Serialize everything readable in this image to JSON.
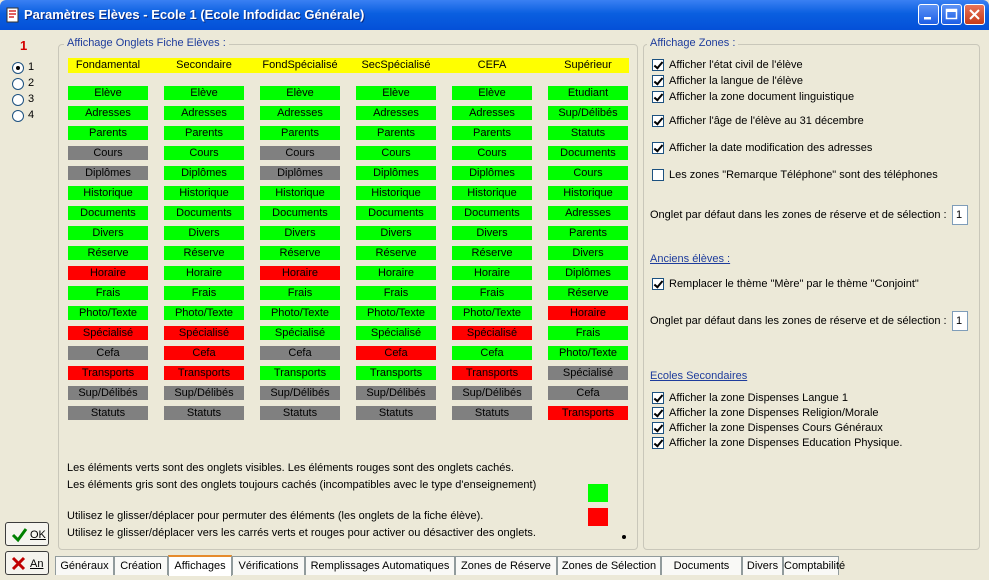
{
  "window": {
    "title": "Paramètres Elèves - Ecole 1 (Ecole Infodidac Générale)"
  },
  "left": {
    "page_number": "1",
    "radios": [
      {
        "label": "1",
        "checked": true
      },
      {
        "label": "2",
        "checked": false
      },
      {
        "label": "3",
        "checked": false
      },
      {
        "label": "4",
        "checked": false
      }
    ],
    "ok_label": "OK",
    "cancel_label": "An"
  },
  "onglets": {
    "title": "Affichage Onglets Fiche Elèves :",
    "columns": [
      {
        "name": "Fondamental",
        "items": [
          [
            "Elève",
            "green"
          ],
          [
            "Adresses",
            "green"
          ],
          [
            "Parents",
            "green"
          ],
          [
            "Cours",
            "gray"
          ],
          [
            "Diplômes",
            "gray"
          ],
          [
            "Historique",
            "green"
          ],
          [
            "Documents",
            "green"
          ],
          [
            "Divers",
            "green"
          ],
          [
            "Réserve",
            "green"
          ],
          [
            "Horaire",
            "red"
          ],
          [
            "Frais",
            "green"
          ],
          [
            "Photo/Texte",
            "green"
          ],
          [
            "Spécialisé",
            "red"
          ],
          [
            "Cefa",
            "gray"
          ],
          [
            "Transports",
            "red"
          ],
          [
            "Sup/Délibés",
            "gray"
          ],
          [
            "Statuts",
            "gray"
          ]
        ]
      },
      {
        "name": "Secondaire",
        "items": [
          [
            "Elève",
            "green"
          ],
          [
            "Adresses",
            "green"
          ],
          [
            "Parents",
            "green"
          ],
          [
            "Cours",
            "green"
          ],
          [
            "Diplômes",
            "green"
          ],
          [
            "Historique",
            "green"
          ],
          [
            "Documents",
            "green"
          ],
          [
            "Divers",
            "green"
          ],
          [
            "Réserve",
            "green"
          ],
          [
            "Horaire",
            "green"
          ],
          [
            "Frais",
            "green"
          ],
          [
            "Photo/Texte",
            "green"
          ],
          [
            "Spécialisé",
            "red"
          ],
          [
            "Cefa",
            "red"
          ],
          [
            "Transports",
            "red"
          ],
          [
            "Sup/Délibés",
            "gray"
          ],
          [
            "Statuts",
            "gray"
          ]
        ]
      },
      {
        "name": "FondSpécialisé",
        "items": [
          [
            "Elève",
            "green"
          ],
          [
            "Adresses",
            "green"
          ],
          [
            "Parents",
            "green"
          ],
          [
            "Cours",
            "gray"
          ],
          [
            "Diplômes",
            "gray"
          ],
          [
            "Historique",
            "green"
          ],
          [
            "Documents",
            "green"
          ],
          [
            "Divers",
            "green"
          ],
          [
            "Réserve",
            "green"
          ],
          [
            "Horaire",
            "red"
          ],
          [
            "Frais",
            "green"
          ],
          [
            "Photo/Texte",
            "green"
          ],
          [
            "Spécialisé",
            "green"
          ],
          [
            "Cefa",
            "gray"
          ],
          [
            "Transports",
            "green"
          ],
          [
            "Sup/Délibés",
            "gray"
          ],
          [
            "Statuts",
            "gray"
          ]
        ]
      },
      {
        "name": "SecSpécialisé",
        "items": [
          [
            "Elève",
            "green"
          ],
          [
            "Adresses",
            "green"
          ],
          [
            "Parents",
            "green"
          ],
          [
            "Cours",
            "green"
          ],
          [
            "Diplômes",
            "green"
          ],
          [
            "Historique",
            "green"
          ],
          [
            "Documents",
            "green"
          ],
          [
            "Divers",
            "green"
          ],
          [
            "Réserve",
            "green"
          ],
          [
            "Horaire",
            "green"
          ],
          [
            "Frais",
            "green"
          ],
          [
            "Photo/Texte",
            "green"
          ],
          [
            "Spécialisé",
            "green"
          ],
          [
            "Cefa",
            "red"
          ],
          [
            "Transports",
            "green"
          ],
          [
            "Sup/Délibés",
            "gray"
          ],
          [
            "Statuts",
            "gray"
          ]
        ]
      },
      {
        "name": "CEFA",
        "items": [
          [
            "Elève",
            "green"
          ],
          [
            "Adresses",
            "green"
          ],
          [
            "Parents",
            "green"
          ],
          [
            "Cours",
            "green"
          ],
          [
            "Diplômes",
            "green"
          ],
          [
            "Historique",
            "green"
          ],
          [
            "Documents",
            "green"
          ],
          [
            "Divers",
            "green"
          ],
          [
            "Réserve",
            "green"
          ],
          [
            "Horaire",
            "green"
          ],
          [
            "Frais",
            "green"
          ],
          [
            "Photo/Texte",
            "green"
          ],
          [
            "Spécialisé",
            "red"
          ],
          [
            "Cefa",
            "green"
          ],
          [
            "Transports",
            "red"
          ],
          [
            "Sup/Délibés",
            "gray"
          ],
          [
            "Statuts",
            "gray"
          ]
        ]
      },
      {
        "name": "Supérieur",
        "items": [
          [
            "Etudiant",
            "green"
          ],
          [
            "Sup/Délibés",
            "green"
          ],
          [
            "Statuts",
            "green"
          ],
          [
            "Documents",
            "green"
          ],
          [
            "Cours",
            "green"
          ],
          [
            "Historique",
            "green"
          ],
          [
            "Adresses",
            "green"
          ],
          [
            "Parents",
            "green"
          ],
          [
            "Divers",
            "green"
          ],
          [
            "Diplômes",
            "green"
          ],
          [
            "Réserve",
            "green"
          ],
          [
            "Horaire",
            "red"
          ],
          [
            "Frais",
            "green"
          ],
          [
            "Photo/Texte",
            "green"
          ],
          [
            "Spécialisé",
            "gray"
          ],
          [
            "Cefa",
            "gray"
          ],
          [
            "Transports",
            "red"
          ]
        ]
      }
    ],
    "info1": "Les éléments verts sont des onglets visibles.  Les éléments rouges sont des onglets cachés.",
    "info2": "Les éléments gris sont des onglets toujours cachés (incompatibles avec le type d'enseignement)",
    "info3": "Utilisez le glisser/déplacer pour permuter des éléments (les onglets de la fiche élève).",
    "info4": "Utilisez le glisser/déplacer vers les carrés verts et rouges pour activer ou désactiver des onglets.",
    "colors": {
      "green": "#00ff00",
      "red": "#ff0000",
      "gray": "#808080",
      "yellow": "#ffff00"
    }
  },
  "zones": {
    "title": "Affichage Zones :",
    "checks": [
      {
        "label": "Afficher l'état civil de l'élève",
        "checked": true
      },
      {
        "label": "Afficher la langue de l'élève",
        "checked": true
      },
      {
        "label": "Afficher la zone document linguistique",
        "checked": true
      },
      {
        "label": "Afficher l'âge de l'élève au 31 décembre",
        "checked": true
      },
      {
        "label": "Afficher la date modification des adresses",
        "checked": true
      },
      {
        "label": "Les zones \"Remarque Téléphone\" sont des téléphones",
        "checked": false
      }
    ],
    "onglet_label": "Onglet par défaut dans les zones de réserve et de sélection :",
    "onglet_value": "1",
    "anciens_title": "Anciens élèves :",
    "anciens_check": {
      "label": "Remplacer le thème \"Mère\" par  le thème \"Conjoint\"",
      "checked": true
    },
    "onglet2_label": "Onglet par défaut dans les zones de réserve et de sélection :",
    "onglet2_value": "1",
    "ecoles_title": "Ecoles Secondaires",
    "ecoles_checks": [
      {
        "label": "Afficher la zone Dispenses Langue 1",
        "checked": true
      },
      {
        "label": "Afficher la zone Dispenses Religion/Morale",
        "checked": true
      },
      {
        "label": "Afficher la zone Dispenses Cours Généraux",
        "checked": true
      },
      {
        "label": "Afficher la zone Dispenses Education Physique.",
        "checked": true
      }
    ]
  },
  "tabs": [
    {
      "label": "Généraux",
      "active": false
    },
    {
      "label": "Création",
      "active": false
    },
    {
      "label": "Affichages",
      "active": true
    },
    {
      "label": "Vérifications",
      "active": false
    },
    {
      "label": "Remplissages Automatiques",
      "active": false
    },
    {
      "label": "Zones de Réserve",
      "active": false
    },
    {
      "label": "Zones de Sélection",
      "active": false
    },
    {
      "label": "Documents",
      "active": false
    },
    {
      "label": "Divers",
      "active": false
    },
    {
      "label": "Comptabilité",
      "active": false
    }
  ]
}
